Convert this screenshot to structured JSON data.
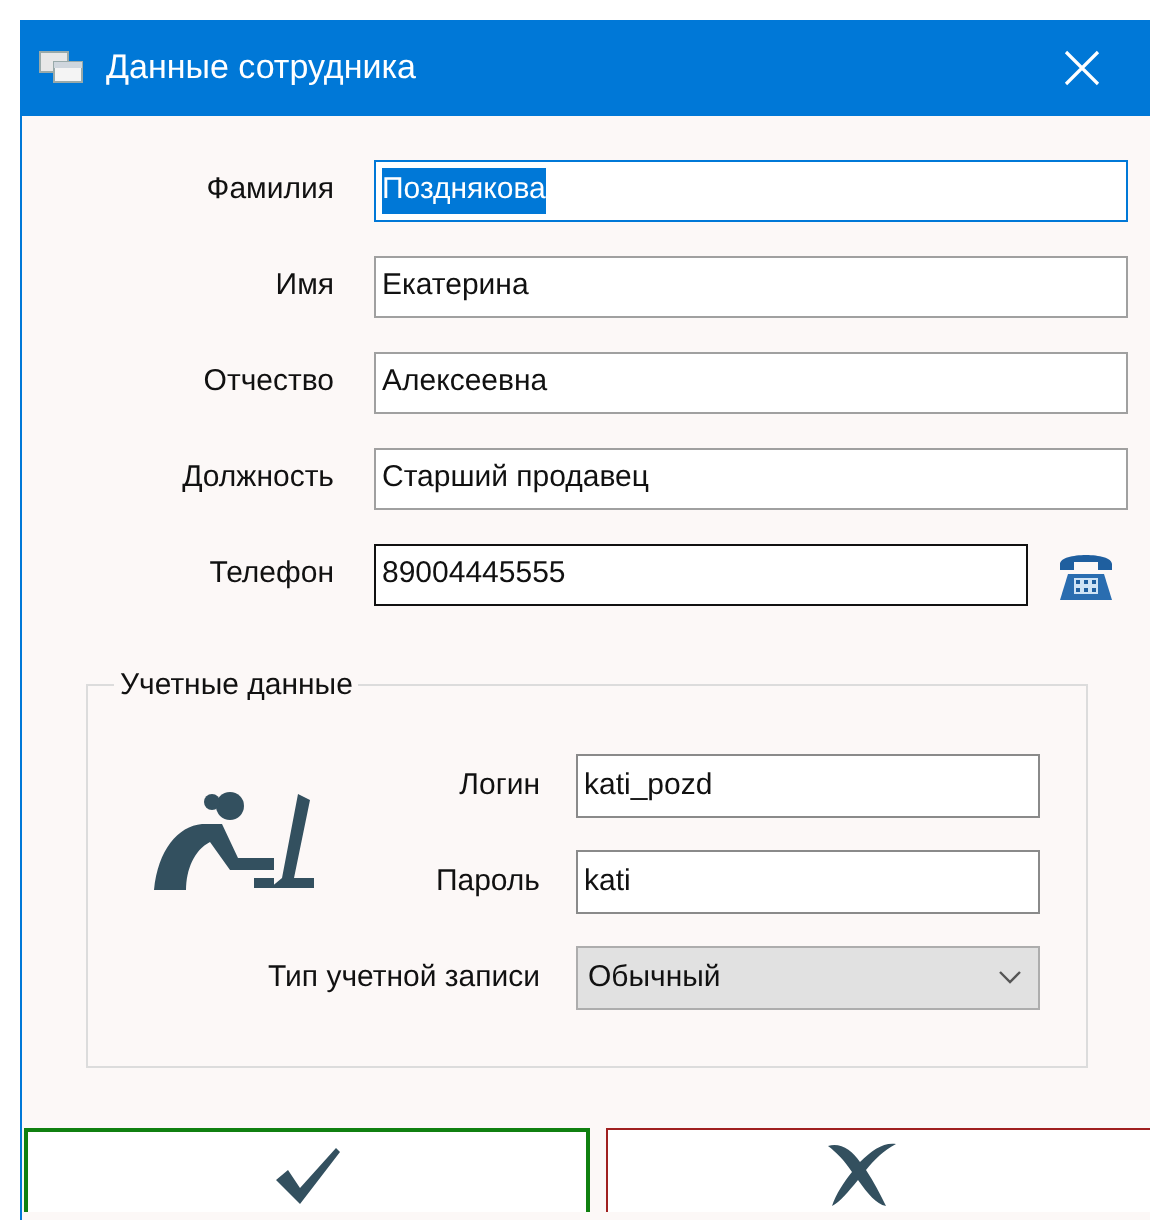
{
  "window": {
    "title": "Данные сотрудника"
  },
  "fields": [
    {
      "label": "Фамилия",
      "value": "Позднякова",
      "focused": true,
      "hovered": false
    },
    {
      "label": "Имя",
      "value": "Екатерина",
      "focused": false,
      "hovered": false
    },
    {
      "label": "Отчество",
      "value": "Алексеевна",
      "focused": false,
      "hovered": false
    },
    {
      "label": "Должность",
      "value": "Старший продавец",
      "focused": false,
      "hovered": false
    },
    {
      "label": "Телефон",
      "value": "89004445555",
      "focused": false,
      "hovered": true
    }
  ],
  "account": {
    "title": "Учетные данные",
    "fields": [
      {
        "kind": "text",
        "label": "Логин",
        "value": "kati_pozd"
      },
      {
        "kind": "text",
        "label": "Пароль",
        "value": "kati"
      },
      {
        "kind": "select",
        "label": "Тип учетной записи",
        "value": "Обычный"
      }
    ]
  }
}
